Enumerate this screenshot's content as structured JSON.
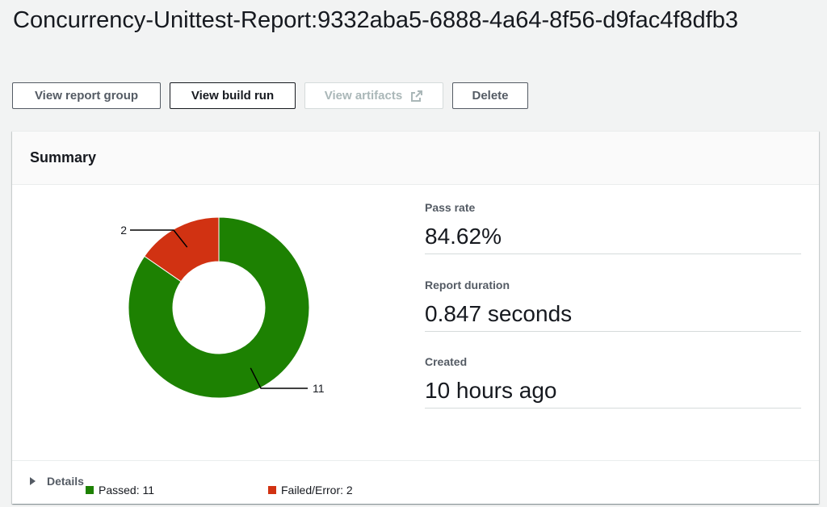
{
  "page": {
    "title": "Concurrency-Unittest-Report:9332aba5-6888-4a64-8f56-d9fac4f8dfb3"
  },
  "actions": {
    "view_report_group": "View report group",
    "view_build_run": "View build run",
    "view_artifacts": "View artifacts",
    "delete": "Delete"
  },
  "summary": {
    "title": "Summary",
    "pass_rate_label": "Pass rate",
    "pass_rate_value": "84.62%",
    "duration_label": "Report duration",
    "duration_value": "0.847 seconds",
    "created_label": "Created",
    "created_value": "10 hours ago",
    "details_label": "Details"
  },
  "colors": {
    "passed": "#1d8102",
    "failed": "#d13212"
  },
  "chart_data": {
    "type": "pie",
    "categories": [
      "Passed",
      "Failed/Error"
    ],
    "values": [
      11,
      2
    ],
    "donut": true,
    "slice_labels": [
      "11",
      "2"
    ],
    "legend": [
      "Passed: 11",
      "Failed/Error: 2"
    ],
    "legend_position": "bottom"
  }
}
